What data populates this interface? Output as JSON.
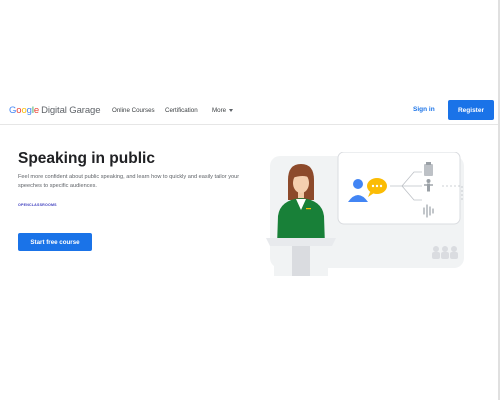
{
  "header": {
    "logo_google": [
      "G",
      "o",
      "o",
      "g",
      "l",
      "e"
    ],
    "logo_product": "Digital Garage",
    "nav": {
      "online_courses": "Online Courses",
      "certification": "Certification",
      "more": "More"
    },
    "sign_in": "Sign in",
    "register": "Register"
  },
  "hero": {
    "title": "Speaking in public",
    "description": "Feel more confident about public speaking, and learn how to quickly and easily tailor your speeches to specific audiences.",
    "partner_label": "OPENCLASSROOMS",
    "cta": "Start free course"
  },
  "colors": {
    "accent": "#1a73e8",
    "speaker_jacket": "#188038",
    "speech_bubble": "#fbbc04",
    "person_icon": "#4285f4"
  },
  "icons": [
    "chevron-down-icon",
    "person-icon",
    "speech-bubble-icon",
    "clipboard-icon",
    "standing-person-icon",
    "sound-wave-icon",
    "audience-icon"
  ]
}
